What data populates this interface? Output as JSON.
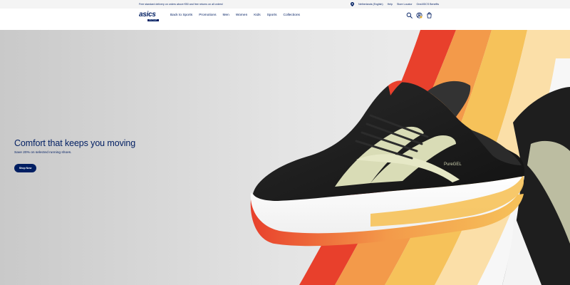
{
  "topbar": {
    "promo": "Free standard delivery on orders above €50 and free returns on all orders!",
    "location": "Netherlands (English)",
    "help": "Help",
    "store_locator": "Store Locator",
    "benefits": "OneASICS Benefits"
  },
  "brand": {
    "logo_text": "asics",
    "logo_badge": "OUTLET",
    "color": "#001e62"
  },
  "nav": {
    "items": [
      {
        "label": "Back to Sports"
      },
      {
        "label": "Promotions"
      },
      {
        "label": "Men"
      },
      {
        "label": "Women"
      },
      {
        "label": "Kids"
      },
      {
        "label": "Sports"
      },
      {
        "label": "Collections"
      }
    ],
    "icons": [
      "search-icon",
      "account-icon",
      "bag-icon"
    ]
  },
  "hero": {
    "title": "Comfort that keeps you moving",
    "subtitle": "Save 20% on selected running shoes.",
    "cta": "Shop Now",
    "shoe_text": "PureGEL"
  }
}
